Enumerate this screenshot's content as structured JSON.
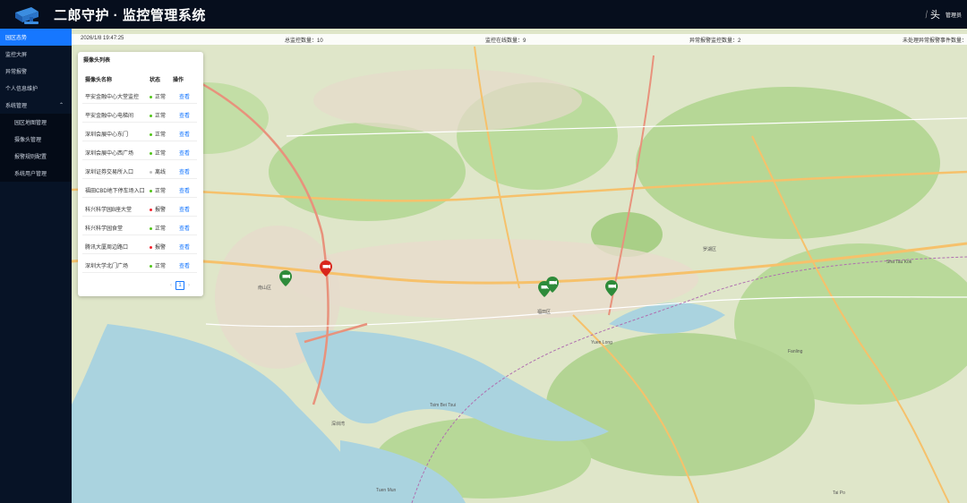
{
  "header": {
    "title": "二郎守护 · 监控管理系统",
    "avatar_text": "头",
    "user_name": "管理员"
  },
  "sidebar": {
    "items": [
      {
        "label": "园区态势",
        "active": true
      },
      {
        "label": "监控大屏"
      },
      {
        "label": "异常报警"
      },
      {
        "label": "个人信息维护"
      },
      {
        "label": "系统管理",
        "expanded": true
      }
    ],
    "sub_items": [
      {
        "label": "园区地图管理"
      },
      {
        "label": "摄像头管理"
      },
      {
        "label": "报警规则配置"
      },
      {
        "label": "系统用户管理"
      }
    ]
  },
  "stats": {
    "datetime": "2026/1/8 19:47:25",
    "total": "总监控数量：10",
    "online": "监控在线数量：9",
    "alarm": "异常报警监控数量：2",
    "pending": "未处理异常报警事件数量："
  },
  "panel": {
    "title": "摄像头列表",
    "columns": {
      "name": "摄像头名称",
      "status": "状态",
      "action": "操作"
    },
    "rows": [
      {
        "name": "平安金融中心大堂监控",
        "status": "正常",
        "color": "#52c41a",
        "action": "查看"
      },
      {
        "name": "平安金融中心电梯间",
        "status": "正常",
        "color": "#52c41a",
        "action": "查看"
      },
      {
        "name": "深圳会展中心东门",
        "status": "正常",
        "color": "#52c41a",
        "action": "查看"
      },
      {
        "name": "深圳会展中心西广场",
        "status": "正常",
        "color": "#52c41a",
        "action": "查看"
      },
      {
        "name": "深圳证券交易所入口",
        "status": "离线",
        "color": "#bfbfbf",
        "action": "查看"
      },
      {
        "name": "福田CBD地下停车场入口",
        "status": "正常",
        "color": "#52c41a",
        "action": "查看"
      },
      {
        "name": "科兴科学园B座大堂",
        "status": "报警",
        "color": "#f5222d",
        "action": "查看"
      },
      {
        "name": "科兴科学园食堂",
        "status": "正常",
        "color": "#52c41a",
        "action": "查看"
      },
      {
        "name": "腾讯大厦周边路口",
        "status": "报警",
        "color": "#f5222d",
        "action": "查看"
      },
      {
        "name": "深圳大学北门广场",
        "status": "正常",
        "color": "#52c41a",
        "action": "查看"
      }
    ],
    "pager": {
      "prev": "‹",
      "page": "1",
      "next": "›"
    }
  },
  "map": {
    "markers": [
      {
        "name": "camera-marker-normal",
        "state": "normal",
        "color": "#2e8b3a"
      },
      {
        "name": "camera-marker-alarm",
        "state": "alarm",
        "color": "#d9261c"
      },
      {
        "name": "camera-marker-normal",
        "state": "normal",
        "color": "#2e8b3a"
      },
      {
        "name": "camera-marker-normal",
        "state": "normal",
        "color": "#2e8b3a"
      },
      {
        "name": "camera-marker-normal",
        "state": "normal",
        "color": "#2e8b3a"
      }
    ],
    "labels": [
      "南山区",
      "福田区",
      "罗湖区",
      "深圳湾",
      "Tsim Bei Tsui",
      "Sha Tau Kok",
      "Tai Po",
      "Yuen Long",
      "Tuen Mun",
      "Fanling"
    ]
  }
}
